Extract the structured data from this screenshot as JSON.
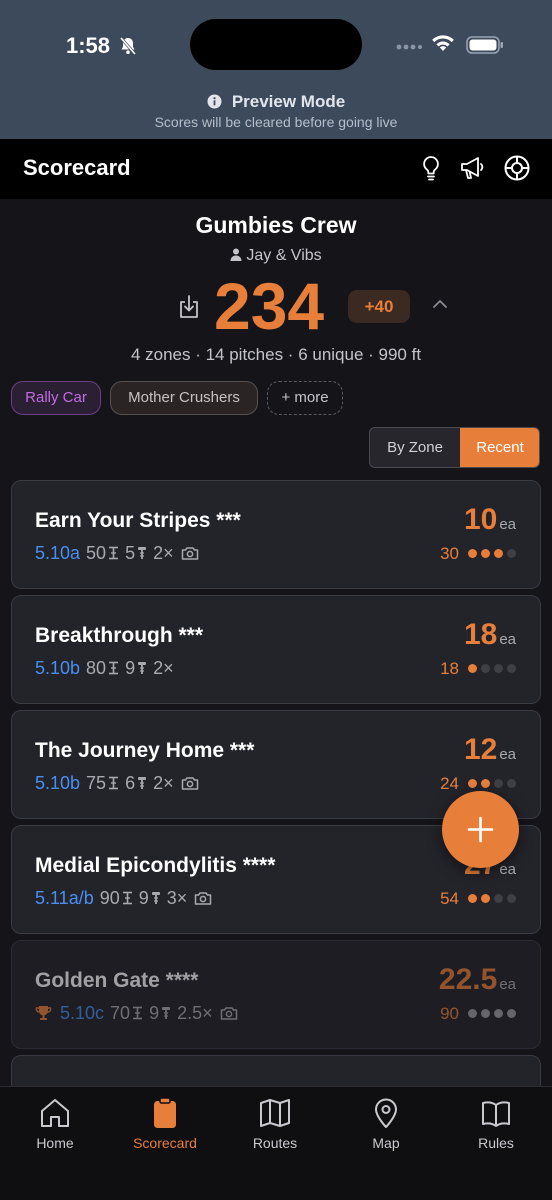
{
  "status_bar": {
    "time": "1:58"
  },
  "preview": {
    "title": "Preview Mode",
    "subtitle": "Scores will be cleared before going live"
  },
  "header": {
    "title": "Scorecard"
  },
  "team": {
    "name": "Gumbies Crew",
    "members": "Jay & Vibs",
    "score": "234",
    "bonus": "+40",
    "stats": "4 zones · 14 pitches · 6 unique · 990 ft"
  },
  "chips": [
    {
      "label": "Rally Car"
    },
    {
      "label": "Mother Crushers"
    },
    {
      "label": "+ more"
    }
  ],
  "sort": {
    "by_zone": "By Zone",
    "recent": "Recent",
    "selected": "Recent"
  },
  "routes": [
    {
      "name": "Earn Your Stripes ***",
      "grade": "5.10a",
      "length": "50",
      "bolts": "5",
      "multiplier": "2×",
      "photo": true,
      "points": "10",
      "unit": "ea",
      "total": "30",
      "count": 3,
      "max": 4,
      "trophy": false,
      "dim": false
    },
    {
      "name": "Breakthrough ***",
      "grade": "5.10b",
      "length": "80",
      "bolts": "9",
      "multiplier": "2×",
      "photo": false,
      "points": "18",
      "unit": "ea",
      "total": "18",
      "count": 1,
      "max": 4,
      "trophy": false,
      "dim": false
    },
    {
      "name": "The Journey Home ***",
      "grade": "5.10b",
      "length": "75",
      "bolts": "6",
      "multiplier": "2×",
      "photo": true,
      "points": "12",
      "unit": "ea",
      "total": "24",
      "count": 2,
      "max": 4,
      "trophy": false,
      "dim": false
    },
    {
      "name": "Medial Epicondylitis ****",
      "grade": "5.11a/b",
      "length": "90",
      "bolts": "9",
      "multiplier": "3×",
      "photo": true,
      "points": "27",
      "unit": "ea",
      "total": "54",
      "count": 2,
      "max": 4,
      "trophy": false,
      "dim": false
    },
    {
      "name": "Golden Gate ****",
      "grade": "5.10c",
      "length": "70",
      "bolts": "9",
      "multiplier": "2.5×",
      "photo": true,
      "points": "22.5",
      "unit": "ea",
      "total": "90",
      "count": 4,
      "max": 4,
      "trophy": true,
      "dim": true
    }
  ],
  "tabs": [
    {
      "label": "Home",
      "icon": "home-icon"
    },
    {
      "label": "Scorecard",
      "icon": "clipboard-icon"
    },
    {
      "label": "Routes",
      "icon": "map-folded-icon"
    },
    {
      "label": "Map",
      "icon": "map-pin-icon"
    },
    {
      "label": "Rules",
      "icon": "book-icon"
    }
  ],
  "active_tab": "Scorecard",
  "colors": {
    "accent": "#e77f3b",
    "grade": "#4a8ff0",
    "background": "#151519",
    "card": "#23232a"
  }
}
